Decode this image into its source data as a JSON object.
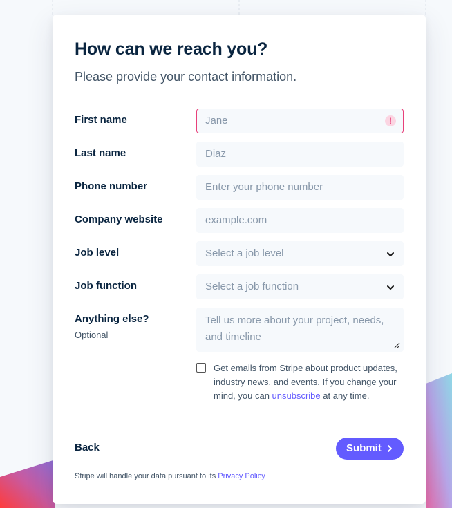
{
  "form": {
    "title": "How can we reach you?",
    "subtitle": "Please provide your contact information.",
    "fields": {
      "first_name": {
        "label": "First name",
        "placeholder": "Jane",
        "error_icon": "alert-icon"
      },
      "last_name": {
        "label": "Last name",
        "placeholder": "Diaz"
      },
      "phone": {
        "label": "Phone number",
        "placeholder": "Enter your phone number"
      },
      "website": {
        "label": "Company website",
        "placeholder": "example.com"
      },
      "job_level": {
        "label": "Job level",
        "selected": "Select a job level"
      },
      "job_function": {
        "label": "Job function",
        "selected": "Select a job function"
      },
      "anything_else": {
        "label": "Anything else?",
        "sublabel": "Optional",
        "placeholder": "Tell us more about your project, needs, and timeline"
      }
    },
    "consent": {
      "text_before": "Get emails from Stripe about product updates, industry news, and events. If you change your mind, you can ",
      "link": "unsubscribe",
      "text_after": " at any time.",
      "checked": false
    },
    "back_label": "Back",
    "submit_label": "Submit",
    "footer_text": "Stripe will handle your data pursuant to its ",
    "footer_link": "Privacy Policy"
  },
  "colors": {
    "accent": "#635bff",
    "heading": "#0a2540",
    "error": "#e8407a",
    "field_bg": "#f6f9fc"
  }
}
